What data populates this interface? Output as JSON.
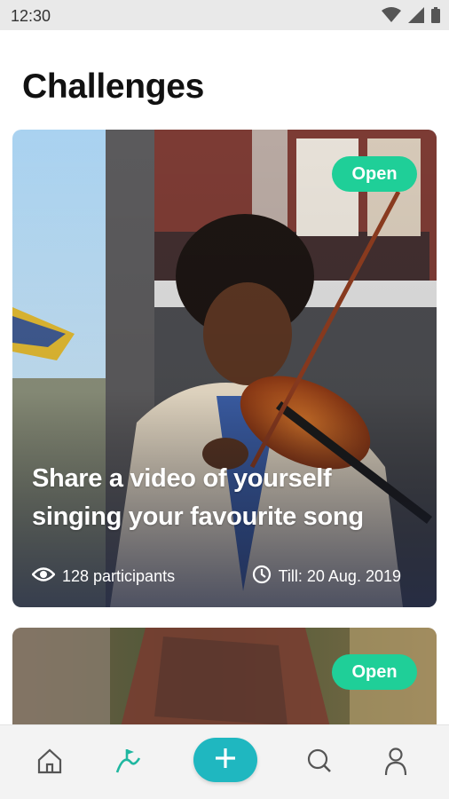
{
  "status_bar": {
    "time": "12:30",
    "icons": [
      "wifi-icon",
      "signal-icon",
      "battery-icon"
    ]
  },
  "page": {
    "title": "Challenges"
  },
  "cards": [
    {
      "badge": "Open",
      "title": "Share a video of yourself singing your favourite song",
      "participants": "128 participants",
      "deadline": "Till: 20 Aug. 2019",
      "participants_icon": "eye-icon",
      "deadline_icon": "clock-icon"
    },
    {
      "badge": "Open"
    }
  ],
  "bottom_nav": {
    "items": [
      "home-icon",
      "challenges-icon",
      "add-icon",
      "search-icon",
      "profile-icon"
    ],
    "active": "challenges-icon"
  },
  "colors": {
    "accent_green": "#1fcf98",
    "accent_teal": "#1fb7c0",
    "status_bar": "#e9e9e9"
  }
}
